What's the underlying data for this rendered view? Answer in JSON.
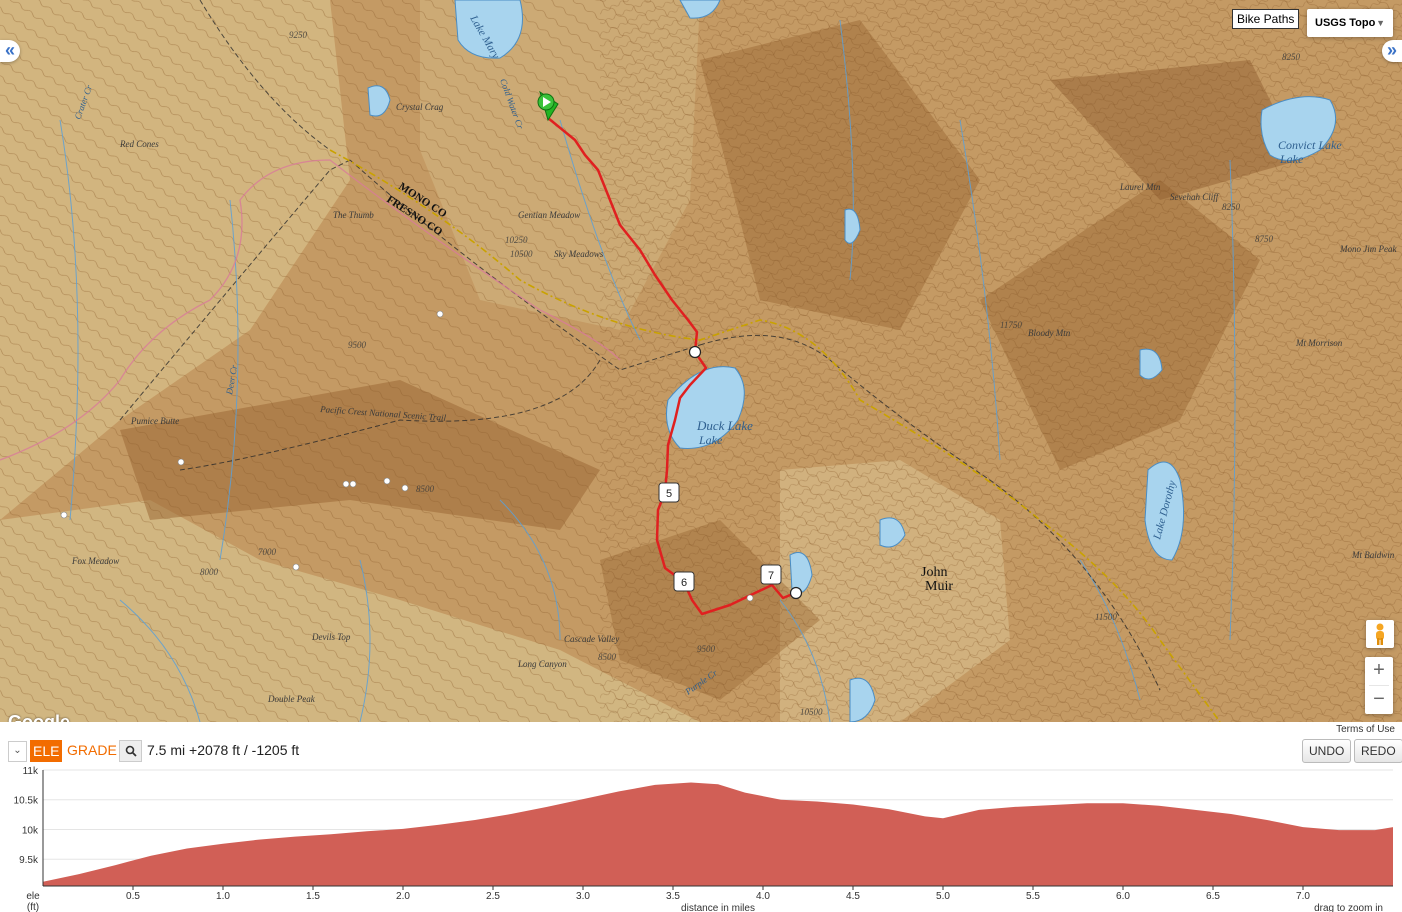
{
  "map": {
    "layer_button": "Bike Paths",
    "layer_select": "USGS Topo",
    "google_logo": "Google",
    "terms": "Terms of Use",
    "labels": {
      "lake_mary": "Lake Mary",
      "duck_lake": "Duck Lake",
      "duck_lake2": "Lake",
      "convict_lake": "Convict Lake",
      "convict_lake2": "Lake",
      "lake_dorothy": "Lake Dorothy",
      "john_muir": "John",
      "john_muir2": "Muir",
      "mono_co": "MONO CO",
      "fresno_co": "FRESNO CO",
      "the_thumb": "The Thumb",
      "gentian_meadow": "Gentian Meadow",
      "sky_meadows": "Sky Meadows",
      "crystal_crag": "Crystal Crag",
      "red_cones": "Red Cones",
      "pumice_butte": "Pumice Butte",
      "pct": "Pacific Crest National Scenic Trail",
      "fox_meadow": "Fox Meadow",
      "devils_top": "Devils Top",
      "double_peak": "Double Peak",
      "cascade_valley": "Cascade Valley",
      "long_canyon": "Long Canyon",
      "purple_cr": "Purple Cr",
      "bloody_mtn": "Bloody Mtn",
      "laurel_mtn": "Laurel Mtn",
      "sevehah_cliff": "Sevehah Cliff",
      "mono_jim_peak": "Mono Jim Peak",
      "mt_morrison": "Mt Morrison",
      "mt_baldwin": "Mt Baldwin",
      "deer_cr": "Deer Cr",
      "crater_cr": "Crater Cr",
      "cold_water_cr": "Cold Water Cr"
    },
    "markers": [
      "5",
      "6",
      "7"
    ],
    "colors": {
      "route": "#e02020",
      "water": "#a8d4ee",
      "terrain": "#c49a64",
      "contour": "#8a5a2a"
    }
  },
  "elevation": {
    "tab_ele": "ELE",
    "tab_grade": "GRADE",
    "stats": "7.5 mi +2078 ft / -1205 ft",
    "undo": "UNDO",
    "redo": "REDO",
    "y_axis_title_1": "ele",
    "y_axis_title_2": "(ft)",
    "x_axis_title": "distance in miles",
    "hint": "drag to zoom in"
  },
  "chart_data": {
    "type": "area",
    "xlabel": "distance in miles",
    "ylabel": "ele (ft)",
    "xlim": [
      0,
      7.5
    ],
    "ylim": [
      9050,
      11000
    ],
    "y_ticks": [
      "9.5k",
      "10k",
      "10.5k",
      "11k"
    ],
    "x_ticks": [
      "0.5",
      "1.0",
      "1.5",
      "2.0",
      "2.5",
      "3.0",
      "3.5",
      "4.0",
      "4.5",
      "5.0",
      "5.5",
      "6.0",
      "6.5",
      "7.0"
    ],
    "color": "#d15f56",
    "x": [
      0,
      0.2,
      0.4,
      0.6,
      0.8,
      1.0,
      1.2,
      1.4,
      1.6,
      1.8,
      2.0,
      2.2,
      2.4,
      2.6,
      2.8,
      3.0,
      3.2,
      3.4,
      3.6,
      3.75,
      3.9,
      4.1,
      4.3,
      4.5,
      4.7,
      4.9,
      5.0,
      5.2,
      5.4,
      5.6,
      5.8,
      6.0,
      6.2,
      6.4,
      6.6,
      6.8,
      7.0,
      7.2,
      7.4,
      7.5
    ],
    "values": [
      9120,
      9250,
      9400,
      9560,
      9680,
      9760,
      9830,
      9880,
      9920,
      9970,
      10010,
      10080,
      10160,
      10260,
      10380,
      10510,
      10640,
      10750,
      10790,
      10760,
      10620,
      10500,
      10470,
      10420,
      10340,
      10220,
      10190,
      10330,
      10380,
      10410,
      10440,
      10440,
      10400,
      10330,
      10260,
      10160,
      10040,
      9990,
      9990,
      10040
    ]
  }
}
